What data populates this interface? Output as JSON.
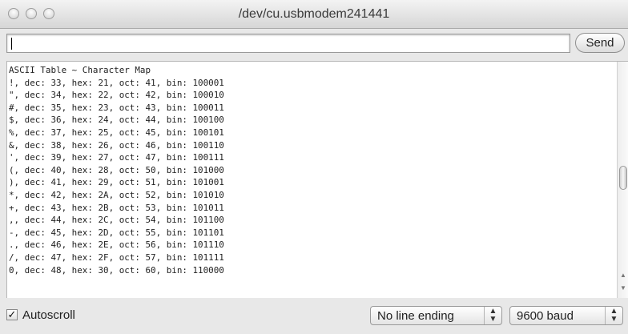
{
  "window": {
    "title": "/dev/cu.usbmodem241441"
  },
  "input": {
    "value": "",
    "send_label": "Send"
  },
  "monitor": {
    "lines": [
      "ASCII Table ~ Character Map",
      "!, dec: 33, hex: 21, oct: 41, bin: 100001",
      "\", dec: 34, hex: 22, oct: 42, bin: 100010",
      "#, dec: 35, hex: 23, oct: 43, bin: 100011",
      "$, dec: 36, hex: 24, oct: 44, bin: 100100",
      "%, dec: 37, hex: 25, oct: 45, bin: 100101",
      "&, dec: 38, hex: 26, oct: 46, bin: 100110",
      "', dec: 39, hex: 27, oct: 47, bin: 100111",
      "(, dec: 40, hex: 28, oct: 50, bin: 101000",
      "), dec: 41, hex: 29, oct: 51, bin: 101001",
      "*, dec: 42, hex: 2A, oct: 52, bin: 101010",
      "+, dec: 43, hex: 2B, oct: 53, bin: 101011",
      ",, dec: 44, hex: 2C, oct: 54, bin: 101100",
      "-, dec: 45, hex: 2D, oct: 55, bin: 101101",
      "., dec: 46, hex: 2E, oct: 56, bin: 101110",
      "/, dec: 47, hex: 2F, oct: 57, bin: 101111",
      "0, dec: 48, hex: 30, oct: 60, bin: 110000"
    ]
  },
  "footer": {
    "autoscroll_label": "Autoscroll",
    "autoscroll_checked": true,
    "check_glyph": "✓",
    "line_ending": "No line ending",
    "baud": "9600 baud",
    "select_arrows": "▲▼"
  },
  "icons": [
    "close-icon",
    "minimize-icon",
    "zoom-icon",
    "checkbox-check-icon",
    "select-arrows-icon",
    "scroll-up-icon",
    "scroll-down-icon"
  ]
}
